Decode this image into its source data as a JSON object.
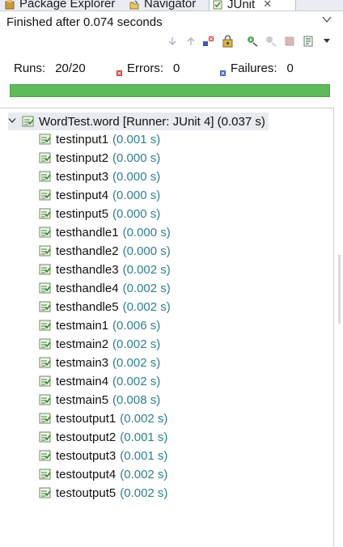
{
  "tabs": {
    "package_explorer": "Package Explorer",
    "navigator": "Navigator",
    "junit": "JUnit",
    "close": "✕"
  },
  "status": "Finished after 0.074 seconds",
  "counters": {
    "runs_label": "Runs:",
    "runs_value": "20/20",
    "errors_label": "Errors:",
    "errors_value": "0",
    "failures_label": "Failures:",
    "failures_value": "0"
  },
  "progress": {
    "fraction": 1.0,
    "color": "#5fba59"
  },
  "tree": {
    "root": {
      "label": "WordTest.word [Runner: JUnit 4] (0.037 s)",
      "expanded": true
    },
    "items": [
      {
        "name": "testinput1",
        "time": "(0.001 s)"
      },
      {
        "name": "testinput2",
        "time": "(0.000 s)"
      },
      {
        "name": "testinput3",
        "time": "(0.000 s)"
      },
      {
        "name": "testinput4",
        "time": "(0.000 s)"
      },
      {
        "name": "testinput5",
        "time": "(0.000 s)"
      },
      {
        "name": "testhandle1",
        "time": "(0.000 s)"
      },
      {
        "name": "testhandle2",
        "time": "(0.000 s)"
      },
      {
        "name": "testhandle3",
        "time": "(0.002 s)"
      },
      {
        "name": "testhandle4",
        "time": "(0.002 s)"
      },
      {
        "name": "testhandle5",
        "time": "(0.002 s)"
      },
      {
        "name": "testmain1",
        "time": "(0.006 s)"
      },
      {
        "name": "testmain2",
        "time": "(0.002 s)"
      },
      {
        "name": "testmain3",
        "time": "(0.002 s)"
      },
      {
        "name": "testmain4",
        "time": "(0.002 s)"
      },
      {
        "name": "testmain5",
        "time": "(0.008 s)"
      },
      {
        "name": "testoutput1",
        "time": "(0.002 s)"
      },
      {
        "name": "testoutput2",
        "time": "(0.001 s)"
      },
      {
        "name": "testoutput3",
        "time": "(0.001 s)"
      },
      {
        "name": "testoutput4",
        "time": "(0.002 s)"
      },
      {
        "name": "testoutput5",
        "time": "(0.002 s)"
      }
    ]
  },
  "icons": {
    "test_passed": "test-passed-icon",
    "suite_passed": "suite-passed-icon",
    "error_marker": "error-marker-icon",
    "failure_marker": "failure-marker-icon"
  },
  "colors": {
    "time_text": "#2e7f8f",
    "progress_green": "#5fba59",
    "error_red": "#d8383a",
    "failure_blue": "#3a5db2"
  }
}
